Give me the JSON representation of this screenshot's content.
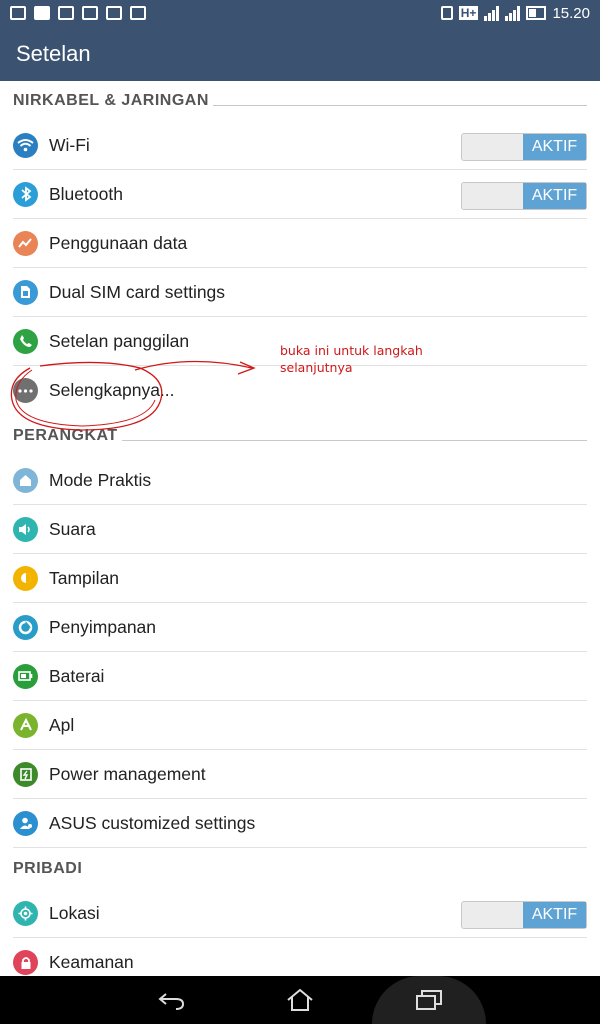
{
  "status_bar": {
    "time": "15.20",
    "network_type": "H+"
  },
  "app_bar": {
    "title": "Setelan"
  },
  "sections": [
    {
      "title": "NIRKABEL & JARINGAN"
    },
    {
      "title": "PERANGKAT"
    },
    {
      "title": "PRIBADI"
    }
  ],
  "items": [
    {
      "label": "Wi-Fi",
      "icon": "wifi-icon",
      "color": "#2a7fc0",
      "toggle": "AKTIF"
    },
    {
      "label": "Bluetooth",
      "icon": "bluetooth-icon",
      "color": "#2b9ed8",
      "toggle": "AKTIF"
    },
    {
      "label": "Penggunaan data",
      "icon": "data-usage-icon",
      "color": "#e98457"
    },
    {
      "label": "Dual SIM card settings",
      "icon": "sim-card-icon",
      "color": "#3a9ad6"
    },
    {
      "label": "Setelan panggilan",
      "icon": "phone-icon",
      "color": "#2fa343"
    },
    {
      "label": "Selengkapnya...",
      "icon": "more-icon",
      "color": "#707070"
    },
    {
      "label": "Mode Praktis",
      "icon": "easy-mode-icon",
      "color": "#7fb6d8"
    },
    {
      "label": "Suara",
      "icon": "sound-icon",
      "color": "#2fb5b0"
    },
    {
      "label": "Tampilan",
      "icon": "display-icon",
      "color": "#f2b400"
    },
    {
      "label": "Penyimpanan",
      "icon": "storage-icon",
      "color": "#2a9cc8"
    },
    {
      "label": "Baterai",
      "icon": "battery-icon",
      "color": "#2a9e3a"
    },
    {
      "label": "Apl",
      "icon": "apps-icon",
      "color": "#7ab42e"
    },
    {
      "label": "Power management",
      "icon": "power-management-icon",
      "color": "#3c8a2a"
    },
    {
      "label": "ASUS customized settings",
      "icon": "asus-settings-icon",
      "color": "#2b8fd0"
    },
    {
      "label": "Lokasi",
      "icon": "location-icon",
      "color": "#2fb4b0",
      "toggle": "AKTIF"
    },
    {
      "label": "Keamanan",
      "icon": "security-icon",
      "color": "#e0445a"
    }
  ],
  "annotation": {
    "line1": "buka ini untuk langkah",
    "line2": "selanjutnya",
    "color": "#d01818"
  },
  "colors": {
    "header": "#3b5371",
    "toggle_on": "#5ea3d3"
  }
}
